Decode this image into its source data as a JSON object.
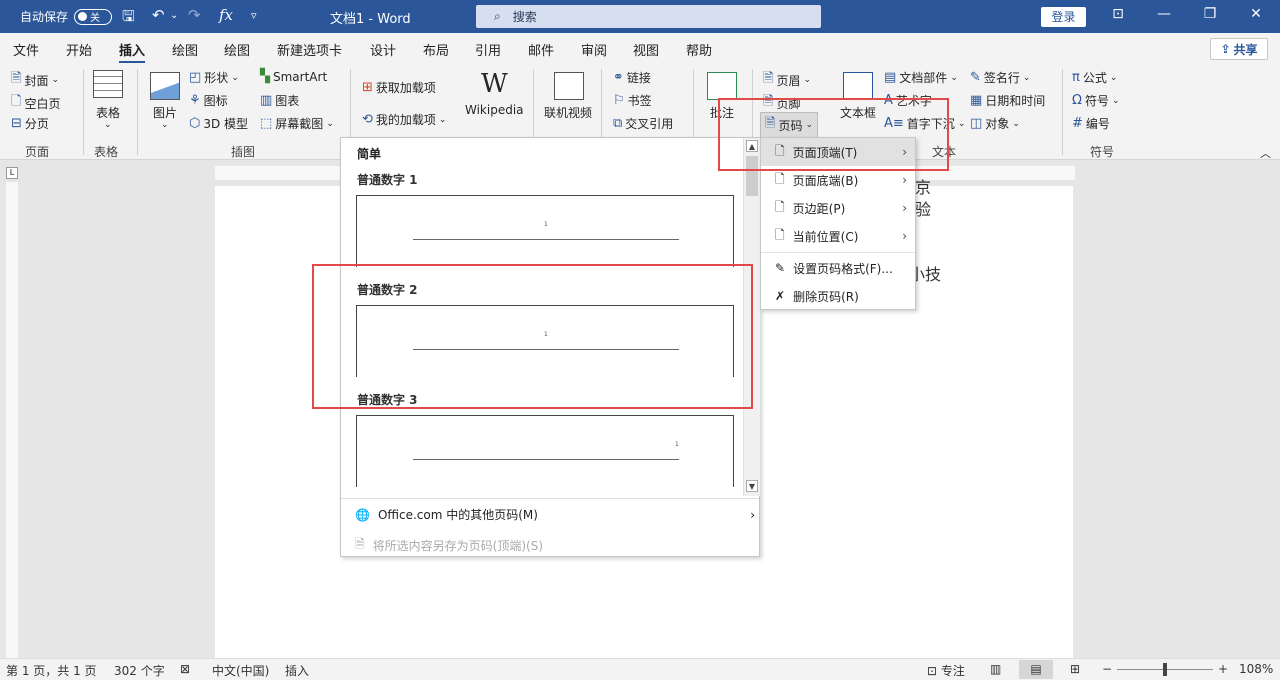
{
  "titlebar": {
    "autosave_label": "自动保存",
    "autosave_toggle": "关",
    "fx_label": "fx",
    "doc_title": "文档1 - Word",
    "search_placeholder": "搜索",
    "login_label": "登录"
  },
  "menu_tabs": [
    "文件",
    "开始",
    "插入",
    "绘图",
    "绘图",
    "新建选项卡",
    "设计",
    "布局",
    "引用",
    "邮件",
    "审阅",
    "视图",
    "帮助"
  ],
  "share_label": "共享",
  "ribbon": {
    "page": {
      "cover": "封面",
      "blank": "空白页",
      "break": "分页",
      "group": "页面"
    },
    "table": {
      "label": "表格",
      "group": "表格"
    },
    "illustrations": {
      "picture": "图片",
      "shapes": "形状",
      "icons": "图标",
      "model3d": "3D 模型",
      "smartart": "SmartArt",
      "chart": "图表",
      "screenshot": "屏幕截图",
      "group": "插图"
    },
    "addins": {
      "get": "获取加载项",
      "mine": "我的加载项",
      "wikipedia": "Wikipedia"
    },
    "media": {
      "video": "联机视频"
    },
    "links": {
      "link": "链接",
      "bookmark": "书签",
      "crossref": "交叉引用"
    },
    "comments": {
      "comment": "批注"
    },
    "header_footer": {
      "header": "页眉",
      "footer": "页脚",
      "pagenum": "页码"
    },
    "text": {
      "textbox": "文本框",
      "quickparts": "文档部件",
      "wordart": "艺术字",
      "dropcap": "首字下沉",
      "signature": "签名行",
      "datetime": "日期和时间",
      "object": "对象",
      "group": "文本"
    },
    "symbols": {
      "equation": "公式",
      "symbol": "符号",
      "number": "编号",
      "group": "符号"
    }
  },
  "gallery": {
    "heading": "简单",
    "items": [
      "普通数字 1",
      "普通数字 2",
      "普通数字 3"
    ],
    "thumb_number": "1",
    "more": "Office.com 中的其他页码(M)",
    "save_selection": "将所选内容另存为页码(顶端)(S)"
  },
  "submenu": {
    "items": [
      "页面顶端(T)",
      "页面底端(B)",
      "页边距(P)",
      "当前位置(C)",
      "设置页码格式(F)...",
      "删除页码(R)"
    ]
  },
  "page_text": [
    "京",
    "验",
    "小技"
  ],
  "statusbar": {
    "page": "第 1 页，共 1 页",
    "words": "302 个字",
    "language": "中文(中国)",
    "mode": "插入",
    "focus": "专注",
    "zoom": "108%"
  }
}
